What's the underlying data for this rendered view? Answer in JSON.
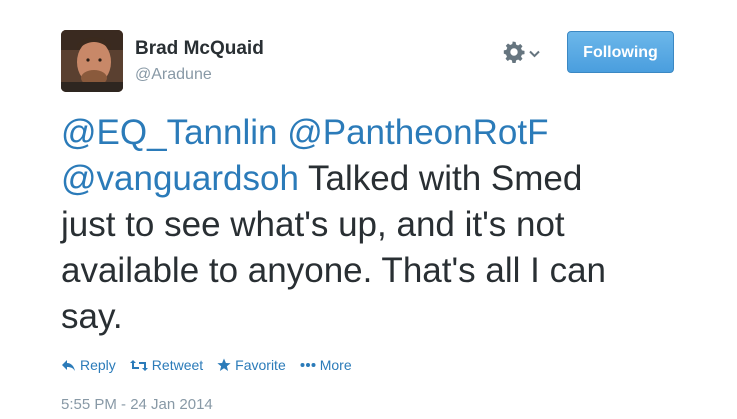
{
  "author": {
    "name": "Brad McQuaid",
    "handle": "@Aradune"
  },
  "header": {
    "follow_label": "Following"
  },
  "tweet": {
    "mention_1": "@EQ_Tannlin",
    "mention_2": "@PantheonRotF",
    "mention_3": "@vanguardsoh",
    "line_1_text": "Talked with Smed",
    "line_3": "just to see what's up, and it's not",
    "line_4": "available to anyone. That's all I can",
    "line_5": "say."
  },
  "actions": {
    "reply": "Reply",
    "retweet": "Retweet",
    "favorite": "Favorite",
    "more": "More"
  },
  "timestamp": "5:55 PM - 24 Jan 2014",
  "colors": {
    "link": "#2b7bb9",
    "follow_button": "#55acee",
    "muted": "#8899a6"
  }
}
